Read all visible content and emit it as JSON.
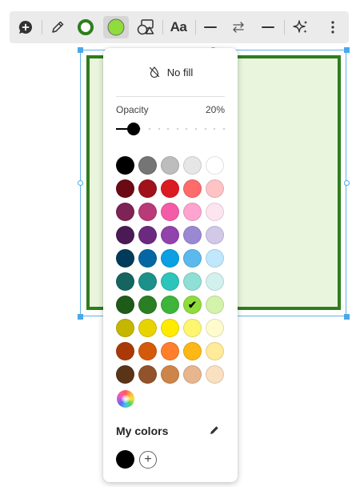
{
  "toolbar": {
    "buttons": [
      {
        "name": "add-comment",
        "icon": "comment-plus-icon"
      },
      {
        "name": "pen",
        "icon": "pencil-icon"
      },
      {
        "name": "border-color",
        "icon": "ring-icon",
        "color": "#2e7d1e"
      },
      {
        "name": "fill-color",
        "icon": "filled-circle-icon",
        "color": "#8fdc3c",
        "active": true
      },
      {
        "name": "shape",
        "icon": "shapes-icon"
      },
      {
        "name": "text-format",
        "label": "Aa"
      },
      {
        "name": "line-start",
        "icon": "dash-icon"
      },
      {
        "name": "swap",
        "icon": "swap-arrows-icon"
      },
      {
        "name": "line-end",
        "icon": "dash-icon"
      },
      {
        "name": "ai",
        "icon": "sparkle-icon"
      },
      {
        "name": "more",
        "icon": "more-vertical-icon"
      }
    ]
  },
  "shape": {
    "border_color": "#2e7d1e",
    "fill_color": "#e9f5dc"
  },
  "popup": {
    "no_fill_label": "No fill",
    "opacity_label": "Opacity",
    "opacity_value": "20%",
    "opacity_fraction": 0.1,
    "palette": [
      [
        "#000000",
        "#757575",
        "#bdbdbd",
        "#e6e6e6",
        "#ffffff"
      ],
      [
        "#6b0a12",
        "#a0111c",
        "#db1a21",
        "#ff6b6b",
        "#ffc3c6"
      ],
      [
        "#7d2356",
        "#b83a78",
        "#f45ca7",
        "#ffa4cf",
        "#fde5ef"
      ],
      [
        "#4a1a55",
        "#6b2a7f",
        "#9142ad",
        "#9a89d2",
        "#d2c8e8"
      ],
      [
        "#013b5a",
        "#0467a3",
        "#0aa0e3",
        "#5cb9ee",
        "#c0e7fb"
      ],
      [
        "#14655f",
        "#1b918a",
        "#2cc4bb",
        "#8ee0d6",
        "#d2f1ee"
      ],
      [
        "#1e5b19",
        "#2a7e23",
        "#3cb53a",
        "#8fdc3c",
        "#d3f3ab"
      ],
      [
        "#c5b700",
        "#e7d300",
        "#ffea00",
        "#fff670",
        "#fffbcc"
      ],
      [
        "#a93a08",
        "#d45a0a",
        "#ff7f2c",
        "#fdb815",
        "#ffeb99"
      ],
      [
        "#5a3417",
        "#92532a",
        "#cd8549",
        "#e7b58e",
        "#f8e0c1"
      ]
    ],
    "selected": {
      "row": 6,
      "col": 3
    },
    "check_glyph": "✔",
    "my_colors_label": "My colors",
    "my_colors": [
      "#000000"
    ],
    "add_label": "+"
  }
}
